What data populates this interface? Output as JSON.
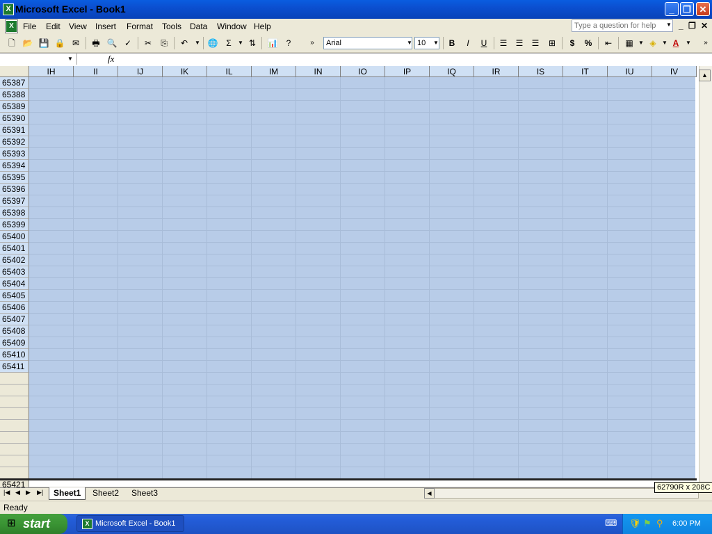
{
  "window": {
    "title": "Microsoft Excel - Book1",
    "icon_glyph": "X",
    "buttons": {
      "minimize": "_",
      "restore": "❐",
      "close": "✕"
    }
  },
  "menu": {
    "items": [
      "File",
      "Edit",
      "View",
      "Insert",
      "Format",
      "Tools",
      "Data",
      "Window",
      "Help"
    ],
    "help_placeholder": "Type a question for help"
  },
  "toolbar": {
    "font_name": "Arial",
    "font_size": "10",
    "bold": "B",
    "italic": "I",
    "underline": "U",
    "currency": "$",
    "percent": "%",
    "sigma": "Σ",
    "font_color_glyph": "A"
  },
  "formula_bar": {
    "name_box": "",
    "fx": "fx",
    "formula": ""
  },
  "grid": {
    "columns": [
      "IH",
      "II",
      "IJ",
      "IK",
      "IL",
      "IM",
      "IN",
      "IO",
      "IP",
      "IQ",
      "IR",
      "IS",
      "IT",
      "IU",
      "IV"
    ],
    "rows": [
      "65387",
      "65388",
      "65389",
      "65390",
      "65391",
      "65392",
      "65393",
      "65394",
      "65395",
      "65396",
      "65397",
      "65398",
      "65399",
      "65400",
      "65401",
      "65402",
      "65403",
      "65404",
      "65405",
      "65406",
      "65407",
      "65408",
      "65409",
      "65410",
      "65411"
    ],
    "frozen_row_label": "65421"
  },
  "sheets": {
    "tabs": [
      "Sheet1",
      "Sheet2",
      "Sheet3"
    ],
    "active": "Sheet1"
  },
  "tooltip": "62790R x 208C",
  "status": "Ready",
  "taskbar": {
    "start_label": "start",
    "task_label": "Microsoft Excel - Book1",
    "clock": "6:00 PM"
  },
  "colors": {
    "title_bar": "#0b4fd0",
    "selection": "#b8cce8",
    "taskbar": "#245edb",
    "start_button": "#3a9434"
  }
}
